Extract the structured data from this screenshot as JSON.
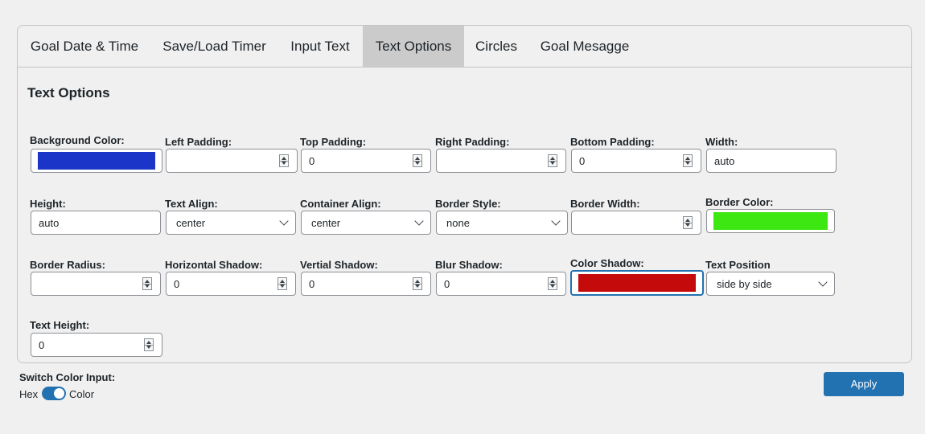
{
  "tabs": [
    {
      "label": "Goal Date & Time"
    },
    {
      "label": "Save/Load Timer"
    },
    {
      "label": "Input Text"
    },
    {
      "label": "Text Options",
      "active": true
    },
    {
      "label": "Circles"
    },
    {
      "label": "Goal Mesagge"
    }
  ],
  "section_title": "Text Options",
  "fields": {
    "background_color": {
      "label": "Background Color:",
      "color": "#1a35c7"
    },
    "left_padding": {
      "label": "Left Padding:",
      "value": ""
    },
    "top_padding": {
      "label": "Top Padding:",
      "value": "0"
    },
    "right_padding": {
      "label": "Right Padding:",
      "value": ""
    },
    "bottom_padding": {
      "label": "Bottom Padding:",
      "value": "0"
    },
    "width": {
      "label": "Width:",
      "value": "auto"
    },
    "height": {
      "label": "Height:",
      "value": "auto"
    },
    "text_align": {
      "label": "Text Align:",
      "value": "center"
    },
    "container_align": {
      "label": "Container Align:",
      "value": "center"
    },
    "border_style": {
      "label": "Border Style:",
      "value": "none"
    },
    "border_width": {
      "label": "Border Width:",
      "value": ""
    },
    "border_color": {
      "label": "Border Color:",
      "color": "#3ce712"
    },
    "border_radius": {
      "label": "Border Radius:",
      "value": ""
    },
    "horizontal_shadow": {
      "label": "Horizontal Shadow:",
      "value": "0"
    },
    "vertical_shadow": {
      "label": "Vertial Shadow:",
      "value": "0"
    },
    "blur_shadow": {
      "label": "Blur Shadow:",
      "value": "0"
    },
    "color_shadow": {
      "label": "Color Shadow:",
      "color": "#c40a0a"
    },
    "text_position": {
      "label": "Text Position",
      "value": "side by side"
    },
    "text_height": {
      "label": "Text Height:",
      "value": "0"
    }
  },
  "switch": {
    "label": "Switch Color Input:",
    "left": "Hex",
    "right": "Color",
    "on": true
  },
  "apply_label": "Apply"
}
